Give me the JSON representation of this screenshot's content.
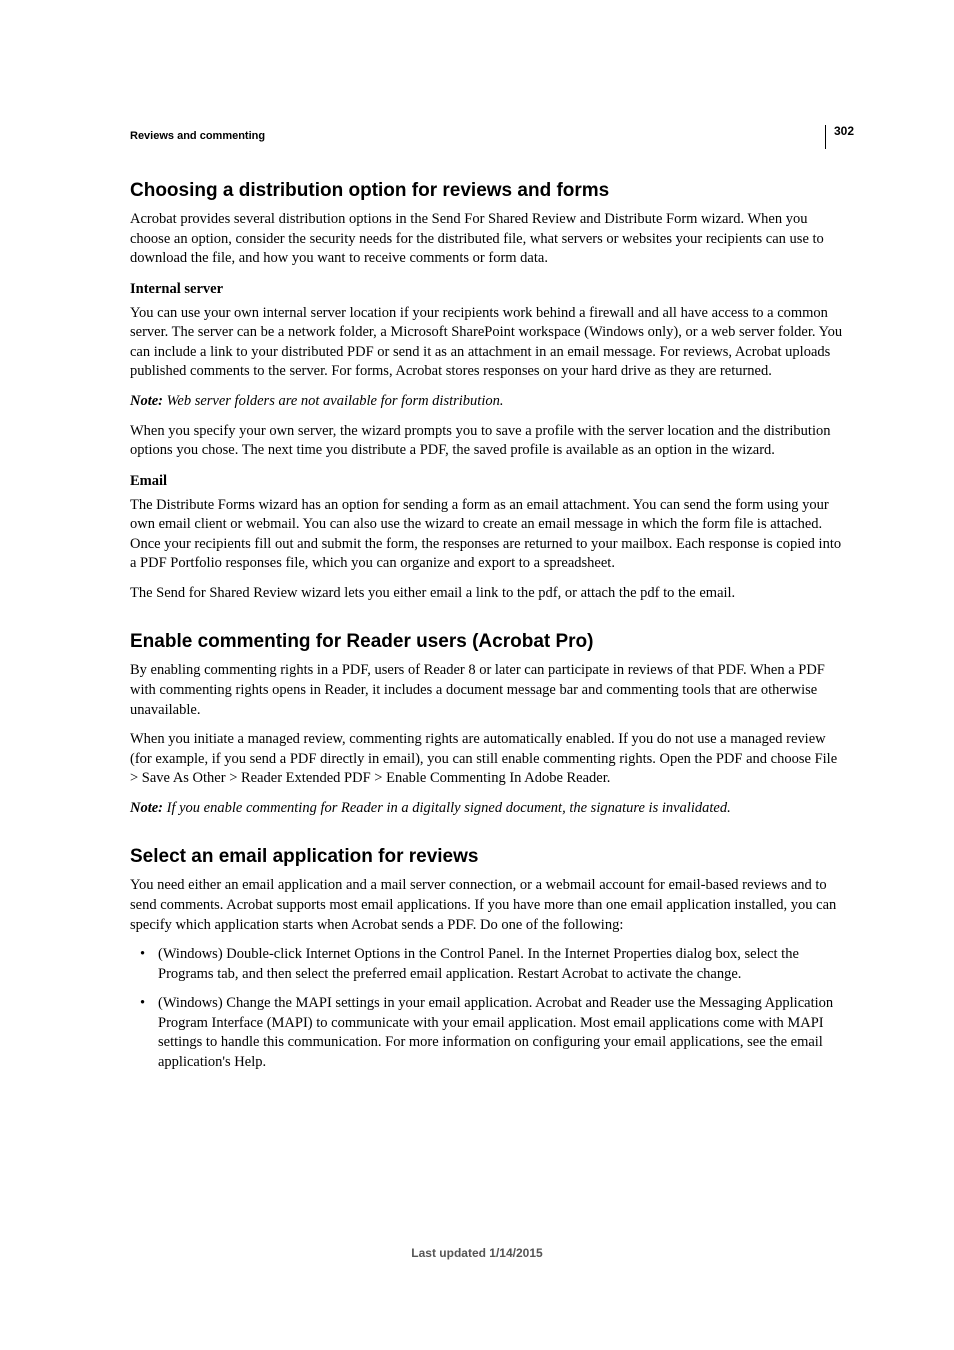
{
  "pageNumber": "302",
  "sectionHeader": "Reviews and commenting",
  "footer": "Last updated 1/14/2015",
  "sections": {
    "s1": {
      "title": "Choosing a distribution option for reviews and forms",
      "p1": "Acrobat provides several distribution options in the Send For Shared Review and Distribute Form wizard. When you choose an option, consider the security needs for the distributed file, what servers or websites your recipients can use to download the file, and how you want to receive comments or form data.",
      "sub1": "Internal server",
      "p2": "You can use your own internal server location if your recipients work behind a firewall and all have access to a common server. The server can be a network folder, a Microsoft SharePoint workspace (Windows only), or a web server folder. You can include a link to your distributed PDF or send it as an attachment in an email message. For reviews, Acrobat uploads published comments to the server. For forms, Acrobat stores responses on your hard drive as they are returned.",
      "noteLabel1": "Note:",
      "note1": " Web server folders are not available for form distribution.",
      "p3": "When you specify your own server, the wizard prompts you to save a profile with the server location and the distribution options you chose. The next time you distribute a PDF, the saved profile is available as an option in the wizard.",
      "sub2": "Email",
      "p4": "The Distribute Forms wizard has an option for sending a form as an email attachment. You can send the form using your own email client or webmail. You can also use the wizard to create an email message in which the form file is attached. Once your recipients fill out and submit the form, the responses are returned to your mailbox. Each response is copied into a PDF Portfolio responses file, which you can organize and export to a spreadsheet.",
      "p5": "The Send for Shared Review wizard lets you either email a link to the pdf, or attach the pdf to the email."
    },
    "s2": {
      "title": "Enable commenting for Reader users (Acrobat Pro)",
      "p1": "By enabling commenting rights in a PDF, users of Reader 8 or later can participate in reviews of that PDF. When a PDF with commenting rights opens in Reader, it includes a document message bar and commenting tools that are otherwise unavailable.",
      "p2": "When you initiate a managed review, commenting rights are automatically enabled. If you do not use a managed review (for example, if you send a PDF directly in email), you can still enable commenting rights. Open the PDF and choose File > Save As Other > Reader Extended PDF > Enable Commenting In Adobe Reader.",
      "noteLabel": "Note:",
      "note": " If you enable commenting for Reader in a digitally signed document, the signature is invalidated."
    },
    "s3": {
      "title": "Select an email application for reviews",
      "p1": "You need either an email application and a mail server connection, or a webmail account for email-based reviews and to send comments. Acrobat supports most email applications. If you have more than one email application installed, you can specify which application starts when Acrobat sends a PDF. Do one of the following:",
      "li1": "(Windows) Double-click Internet Options in the Control Panel. In the Internet Properties dialog box, select the Programs tab, and then select the preferred email application. Restart Acrobat to activate the change.",
      "li2": "(Windows) Change the MAPI settings in your email application. Acrobat and Reader use the Messaging Application Program Interface (MAPI) to communicate with your email application. Most email applications come with MAPI settings to handle this communication. For more information on configuring your email applications, see the email application's Help."
    }
  }
}
